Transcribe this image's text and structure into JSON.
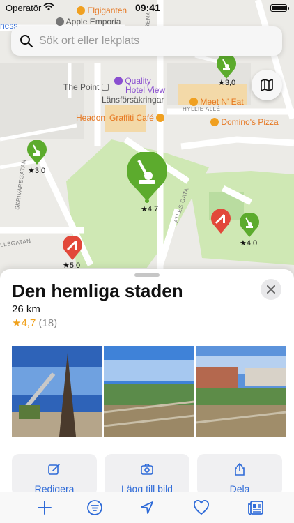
{
  "status": {
    "carrier": "Operatör",
    "time": "09:41"
  },
  "search": {
    "placeholder": "Sök ort eller lekplats"
  },
  "map": {
    "poi": {
      "elgiganten": "Elgiganten",
      "apple": "Apple Emporia",
      "fitness": "ness",
      "quality_line1": "Quality",
      "quality_line2": "Hotel View",
      "the_point": "The Point",
      "lansforsakringar": "Länsförsäkringar",
      "meet_n_eat": "Meet N' Eat",
      "headon": "Headon",
      "graffiti": "Graffiti Café",
      "dominos": "Domino's Pizza"
    },
    "streets": {
      "hyllie_alle": "HYLLIE ALLÉ",
      "skrivaregatan": "SKRIVAREGATAN",
      "atles_gata": "ATLES GATA",
      "llsgatan": "LLSGATAN",
      "arena": "ARENA",
      "gata": "GATA"
    },
    "pins": [
      {
        "rating": "★3,0",
        "color": "#5cab2d"
      },
      {
        "rating": "★3,0",
        "color": "#5cab2d"
      },
      {
        "rating": "★4,7",
        "color": "#5cab2d"
      },
      {
        "rating": "★4,0",
        "color": "#5cab2d"
      },
      {
        "rating": "★5,0",
        "color": "#e2483a"
      }
    ]
  },
  "place": {
    "name": "Den hemliga staden",
    "distance": "26 km",
    "rating_star": "★",
    "rating": "4,7",
    "rating_count": "(18)"
  },
  "actions": {
    "edit": "Redigera",
    "add_photo": "Lägg till bild",
    "share": "Dela"
  },
  "tabs": [
    "add-icon",
    "list-icon",
    "location-icon",
    "heart-icon",
    "news-icon"
  ],
  "colors": {
    "accent": "#2f6bd8",
    "pin_green": "#5cab2d",
    "pin_red": "#e2483a",
    "star": "#f0a11b"
  }
}
